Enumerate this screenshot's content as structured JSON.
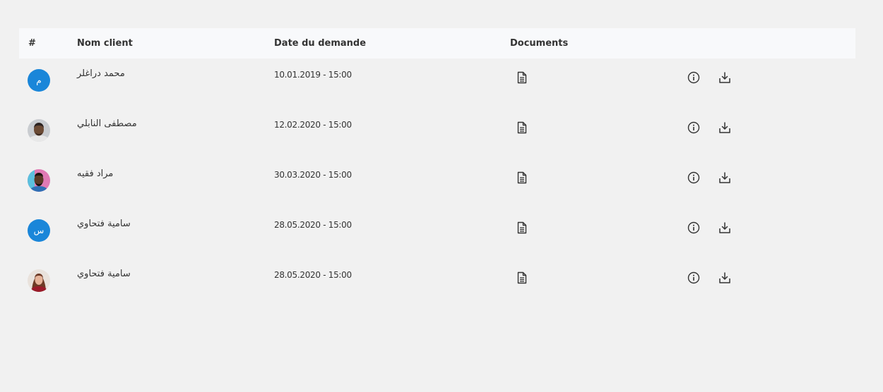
{
  "table": {
    "headers": {
      "num": "#",
      "name": "Nom client",
      "date": "Date du demande",
      "documents": "Documents"
    },
    "rows": [
      {
        "avatar_type": "initial",
        "initial": "م",
        "name": "محمد دراغلر",
        "date": "10.01.2019 - 15:00"
      },
      {
        "avatar_type": "photo",
        "initial": "",
        "name": "مصطفى النابلي",
        "date": "12.02.2020 - 15:00"
      },
      {
        "avatar_type": "photo",
        "initial": "",
        "name": "مراد فقيه",
        "date": "30.03.2020 - 15:00"
      },
      {
        "avatar_type": "initial",
        "initial": "س",
        "name": "سامية فتحاوي",
        "date": "28.05.2020 - 15:00"
      },
      {
        "avatar_type": "photo",
        "initial": "",
        "name": "سامية فتحاوي",
        "date": "28.05.2020 - 15:00"
      }
    ]
  },
  "icons": {
    "document": "document-icon",
    "info": "info-icon",
    "download": "download-icon"
  },
  "colors": {
    "accent": "#1a86d9",
    "background": "#f1f1f1",
    "header_background": "#f8f9fb"
  }
}
